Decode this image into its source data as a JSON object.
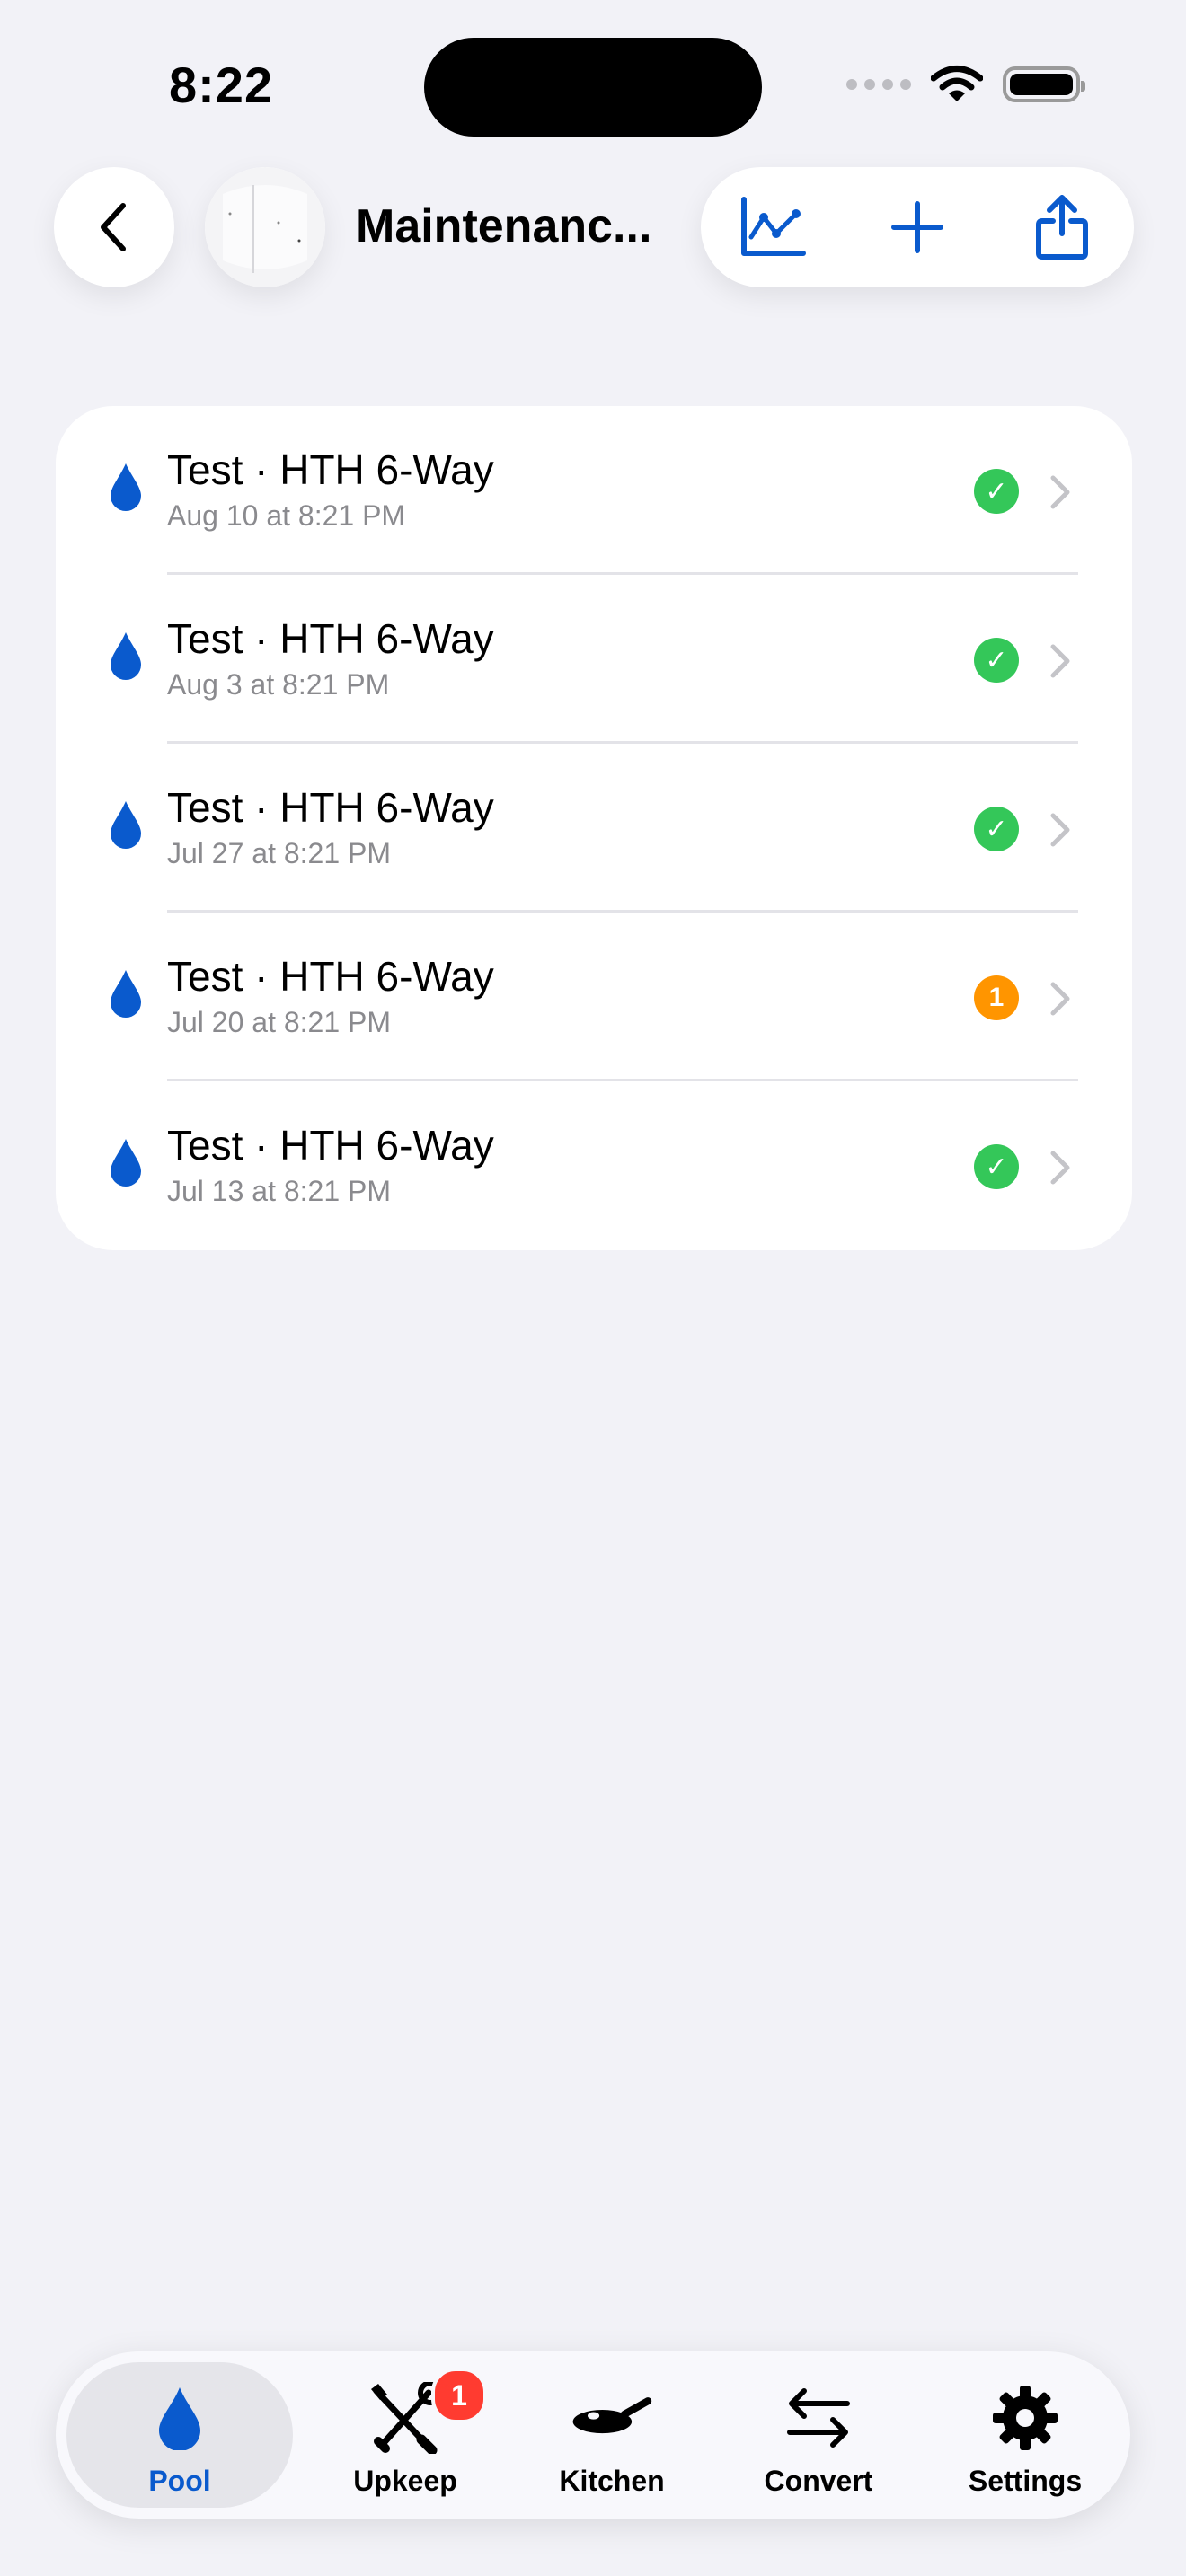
{
  "status_bar": {
    "time": "8:22"
  },
  "nav": {
    "title": "Maintenanc..."
  },
  "colors": {
    "accent": "#0A5ACD",
    "ok": "#34C759",
    "warn": "#FF9500",
    "badge": "#FF3B30"
  },
  "entries": [
    {
      "title": "Test · HTH 6-Way",
      "subtitle": "Aug 10 at 8:21 PM",
      "status": "ok",
      "status_text": "✓"
    },
    {
      "title": "Test · HTH 6-Way",
      "subtitle": "Aug 3 at 8:21 PM",
      "status": "ok",
      "status_text": "✓"
    },
    {
      "title": "Test · HTH 6-Way",
      "subtitle": "Jul 27 at 8:21 PM",
      "status": "ok",
      "status_text": "✓"
    },
    {
      "title": "Test · HTH 6-Way",
      "subtitle": "Jul 20 at 8:21 PM",
      "status": "warn",
      "status_text": "1"
    },
    {
      "title": "Test · HTH 6-Way",
      "subtitle": "Jul 13 at 8:21 PM",
      "status": "ok",
      "status_text": "✓"
    }
  ],
  "tabs": [
    {
      "label": "Pool",
      "icon": "drop-icon",
      "active": true
    },
    {
      "label": "Upkeep",
      "icon": "tools-icon",
      "badge": "1"
    },
    {
      "label": "Kitchen",
      "icon": "pan-icon"
    },
    {
      "label": "Convert",
      "icon": "arrows-icon"
    },
    {
      "label": "Settings",
      "icon": "gear-icon"
    }
  ]
}
